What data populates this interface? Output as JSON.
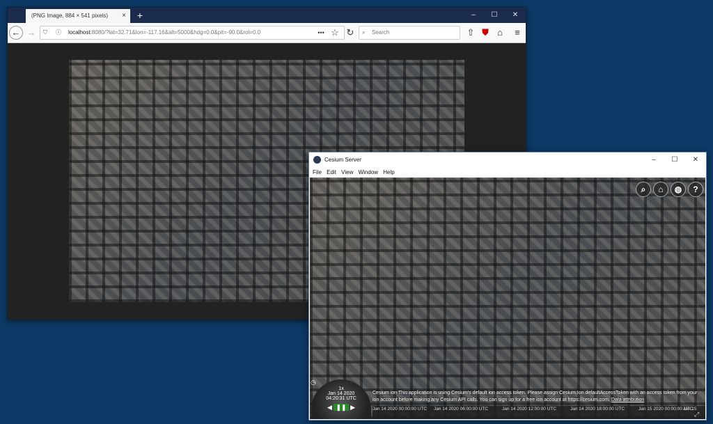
{
  "firefox": {
    "tab_title": "(PNG Image, 884 × 541 pixels)",
    "tab_close": "×",
    "new_tab": "+",
    "url_host": "localhost",
    "url_path": ":8080/?lat=32.71&lon=-117.16&alt=5000&hdg=0.0&pit=-90.0&rol=0.0",
    "search_placeholder": "Search",
    "page_actions": "•••",
    "win_min": "–",
    "win_max": "☐",
    "win_close": "✕"
  },
  "cesium": {
    "title": "Cesium Server",
    "menu": [
      "File",
      "Edit",
      "View",
      "Window",
      "Help"
    ],
    "win_min": "–",
    "win_max": "☐",
    "win_close": "✕",
    "credits_line1": "Cesium ion  This application is using Cesium's default ion access token. Please assign Cesium.Ion.defaultAccessToken with an access token from your",
    "credits_line2": "ion account before making any Cesium API calls. You can sign up for a free ion account at https://cesium.com.",
    "data_attribution": "Data attribution",
    "anim_speed": "1x",
    "anim_date": "Jan 14 2020",
    "anim_time": "04:20:31 UTC",
    "timeline": [
      "Jan 14 2020 00:00:00 UTC",
      "Jan 14 2020 06:00:00 UTC",
      "Jan 14 2020 12:00:00 UTC",
      "Jan 14 2020 18:00:00 UTC",
      "Jan 15 2020 00:00:00 UTC",
      "Jan 15"
    ]
  }
}
